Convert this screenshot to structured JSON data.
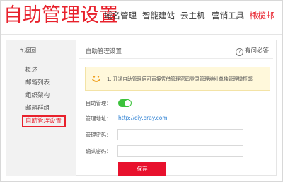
{
  "header": {
    "title": "自助管理设置",
    "nav": [
      "域名管理",
      "智能建站",
      "云主机",
      "营销工具",
      "橄榄邮"
    ]
  },
  "sidebar": {
    "back": "返回",
    "items": [
      "概述",
      "邮箱列表",
      "组织架构",
      "邮箱群组",
      "自助管理设置"
    ]
  },
  "content": {
    "title": "自助管理设置",
    "help": "有问必答",
    "notice": "1. 开通自助管理后可直接凭借管理密码登录管理地址单独管理橄榄邮",
    "form": {
      "enable_label": "自助管理：",
      "enable_state": true,
      "address_label": "管理地址：",
      "address_value": "http://diy.oray.com",
      "password_label": "管理密码：",
      "password_value": "",
      "confirm_label": "确认密码：",
      "confirm_value": "",
      "save": "保存"
    }
  },
  "colors": {
    "brand_red": "#e8212c",
    "toggle_green": "#3cc23c",
    "link_blue": "#2b7fd3",
    "notice_bg": "#fff8db"
  },
  "icons": {
    "back": "arrow-left-icon",
    "help": "question-circle-icon",
    "notice": "smile-face-icon"
  }
}
